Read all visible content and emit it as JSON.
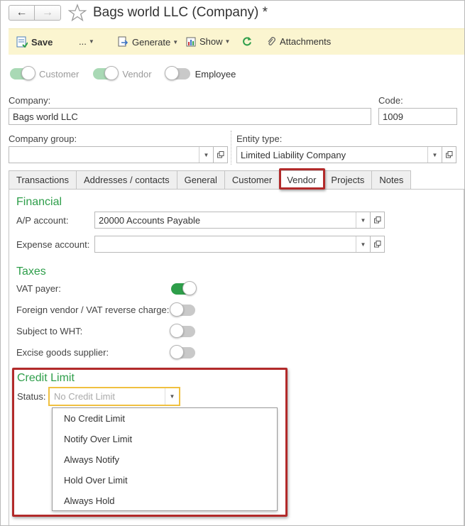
{
  "window": {
    "title": "Bags world LLC (Company) *"
  },
  "toolbar": {
    "save_label": "Save",
    "more_label": "...",
    "generate_label": "Generate",
    "show_label": "Show",
    "attachments_label": "Attachments"
  },
  "roles": {
    "customer_label": "Customer",
    "vendor_label": "Vendor",
    "employee_label": "Employee"
  },
  "form": {
    "company_label": "Company:",
    "company_value": "Bags world LLC",
    "code_label": "Code:",
    "code_value": "1009",
    "company_group_label": "Company group:",
    "company_group_value": "",
    "entity_type_label": "Entity type:",
    "entity_type_value": "Limited Liability Company"
  },
  "tabs": [
    {
      "label": "Transactions"
    },
    {
      "label": "Addresses / contacts"
    },
    {
      "label": "General"
    },
    {
      "label": "Customer"
    },
    {
      "label": "Vendor"
    },
    {
      "label": "Projects"
    },
    {
      "label": "Notes"
    }
  ],
  "financial": {
    "heading": "Financial",
    "ap_label": "A/P account:",
    "ap_value": "20000 Accounts Payable",
    "expense_label": "Expense account:",
    "expense_value": ""
  },
  "taxes": {
    "heading": "Taxes",
    "vat_label": "VAT payer:",
    "foreign_label": "Foreign vendor / VAT reverse charge:",
    "wht_label": "Subject to WHT:",
    "excise_label": "Excise goods supplier:"
  },
  "credit": {
    "heading": "Credit Limit",
    "status_label": "Status:",
    "status_placeholder": "No Credit Limit",
    "options": [
      "No Credit Limit",
      "Notify Over Limit",
      "Always Notify",
      "Hold Over Limit",
      "Always Hold"
    ]
  },
  "colors": {
    "accent_green": "#2e9e4a",
    "toolbar_bg": "#fbf5d0",
    "highlight_red": "#b22a2a",
    "focus_yellow": "#f0c040"
  }
}
